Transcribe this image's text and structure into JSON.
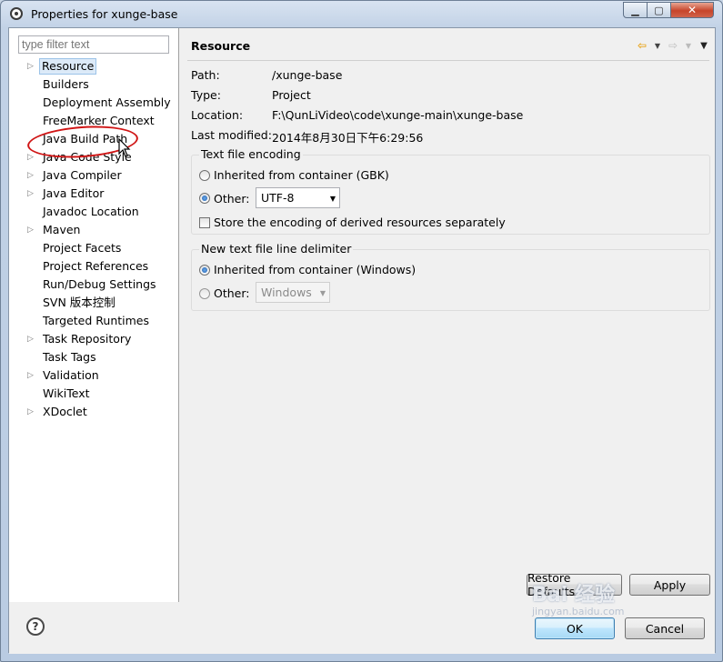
{
  "window": {
    "title": "Properties for xunge-base"
  },
  "filter": {
    "placeholder": "type filter text"
  },
  "tree": [
    {
      "label": "Resource",
      "expandable": true,
      "selected": true
    },
    {
      "label": "Builders",
      "expandable": false
    },
    {
      "label": "Deployment Assembly",
      "expandable": false
    },
    {
      "label": "FreeMarker Context",
      "expandable": false
    },
    {
      "label": "Java Build Path",
      "expandable": false
    },
    {
      "label": "Java Code Style",
      "expandable": true
    },
    {
      "label": "Java Compiler",
      "expandable": true
    },
    {
      "label": "Java Editor",
      "expandable": true
    },
    {
      "label": "Javadoc Location",
      "expandable": false
    },
    {
      "label": "Maven",
      "expandable": true
    },
    {
      "label": "Project Facets",
      "expandable": false
    },
    {
      "label": "Project References",
      "expandable": false
    },
    {
      "label": "Run/Debug Settings",
      "expandable": false
    },
    {
      "label": "SVN 版本控制",
      "expandable": false
    },
    {
      "label": "Targeted Runtimes",
      "expandable": false
    },
    {
      "label": "Task Repository",
      "expandable": true
    },
    {
      "label": "Task Tags",
      "expandable": false
    },
    {
      "label": "Validation",
      "expandable": true
    },
    {
      "label": "WikiText",
      "expandable": false
    },
    {
      "label": "XDoclet",
      "expandable": true
    }
  ],
  "page": {
    "title": "Resource",
    "info": {
      "path_label": "Path:",
      "path": "/xunge-base",
      "type_label": "Type:",
      "type": "Project",
      "location_label": "Location:",
      "location": "F:\\QunLiVideo\\code\\xunge-main\\xunge-base",
      "modified_label": "Last modified:",
      "modified": "2014年8月30日下午6:29:56"
    },
    "encoding": {
      "title": "Text file encoding",
      "inherited_label": "Inherited from container (GBK)",
      "other_label": "Other:",
      "other_value": "UTF-8",
      "store_label": "Store the encoding of derived resources separately"
    },
    "delimiter": {
      "title": "New text file line delimiter",
      "inherited_label": "Inherited from container (Windows)",
      "other_label": "Other:",
      "other_value": "Windows"
    },
    "restore_label": "Restore Defaults",
    "apply_label": "Apply"
  },
  "footer": {
    "ok_label": "OK",
    "cancel_label": "Cancel",
    "help_glyph": "?"
  },
  "watermark": {
    "text": "Bai 经验",
    "sub": "jingyan.baidu.com"
  },
  "colors": {
    "selection": "#dceaf8",
    "annotation": "#d01616",
    "nav_back": "#e8a317"
  }
}
